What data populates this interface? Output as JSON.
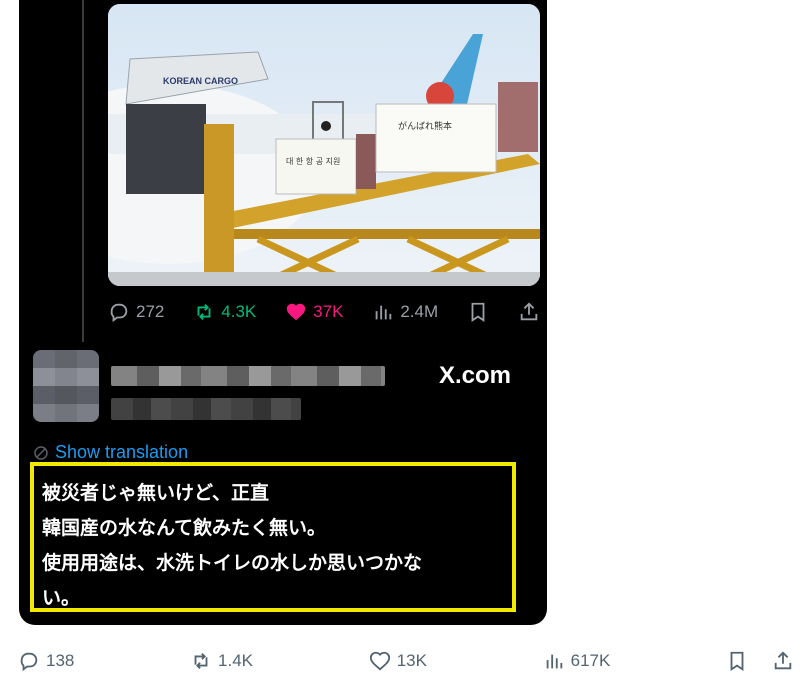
{
  "quoted_tweet": {
    "image_alt_texts": {
      "airline_logo": "KOREAN CARGO",
      "banner_left": "대 한 항 공 지원",
      "banner_right": "がんばれ熊本"
    },
    "actions": {
      "replies": "272",
      "reposts": "4.3K",
      "likes": "37K",
      "views": "2.4M"
    },
    "source_label": "X.com"
  },
  "post": {
    "show_translation": "Show translation",
    "text_lines": [
      "被災者じゃ無いけど、正直",
      "韓国産の水なんて飲みたく無い。",
      "使用用途は、水洗トイレの水しか思いつかな",
      "い。"
    ],
    "actions": {
      "replies": "138",
      "reposts": "1.4K",
      "likes": "13K",
      "views": "617K"
    }
  },
  "colors": {
    "highlight_border": "#f2e800",
    "link": "#1d9bf0",
    "repost_active": "#00ba7c",
    "like_active": "#f91880"
  },
  "icons": [
    "reply-icon",
    "repost-icon",
    "heart-icon",
    "views-icon",
    "bookmark-icon",
    "share-icon",
    "translate-icon"
  ]
}
